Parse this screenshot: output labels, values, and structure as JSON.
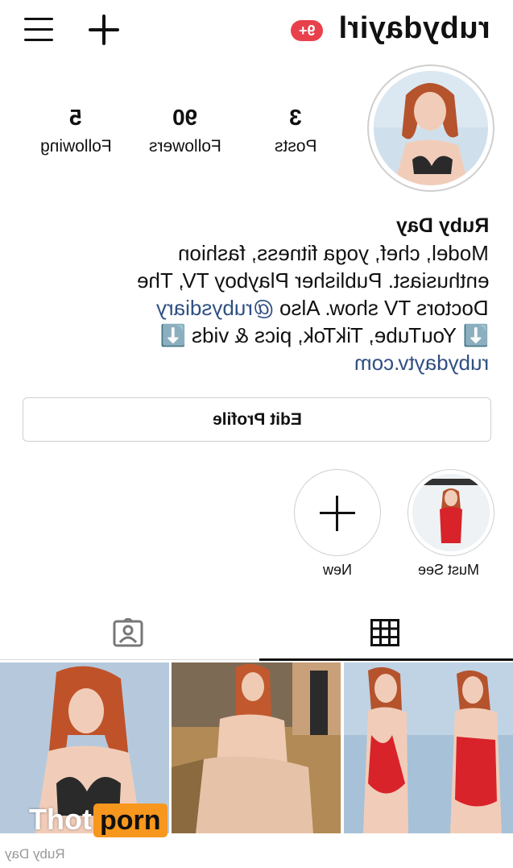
{
  "header": {
    "username": "rubydayirl",
    "notification_badge": "9+",
    "menu_icon": "hamburger-menu-icon",
    "add_icon": "plus-icon"
  },
  "profile": {
    "avatar_alt": "profile photo",
    "stats": [
      {
        "value": "3",
        "label": "Posts"
      },
      {
        "value": "90",
        "label": "Followers"
      },
      {
        "value": "5",
        "label": "Following"
      }
    ],
    "name": "Ruby Day",
    "bio_lines": [
      "Model, chef, yoga fitness, fashion",
      "enthusiast.  Publisher Playboy TV, The",
      "Doctors TV show.  Also",
      "YouTube, TikTok, pics & vids"
    ],
    "mention": "@rubysdiary",
    "website": "rubydaytv.com",
    "emoji_down": "⬇️"
  },
  "edit_profile_label": "Edit Profile",
  "highlights": [
    {
      "label": "Must See"
    },
    {
      "label": "New"
    }
  ],
  "tabs": [
    "grid",
    "tagged"
  ],
  "watermark": {
    "part1": "Thot",
    "part2": "porn",
    "footer": "Ruby Day"
  },
  "colors": {
    "badge": "#e8414b",
    "link": "#2f4f83",
    "accent": "#f7971d",
    "swimsuit": "#d8232a"
  }
}
